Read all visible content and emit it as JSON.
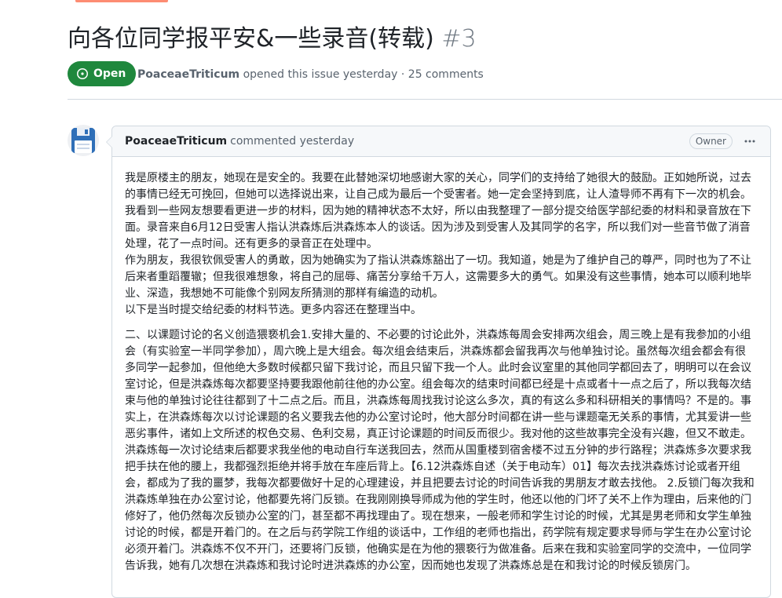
{
  "issue": {
    "title": "向各位同学报平安&一些录音(转载)",
    "number": "#3",
    "state": "Open",
    "author": "PoaceaeTriticum",
    "opened_text": "opened this issue yesterday · 25 comments"
  },
  "comment": {
    "author": "PoaceaeTriticum",
    "time_text": "commented yesterday",
    "badge": "Owner",
    "paragraphs": [
      [
        "我是原楼主的朋友，她现在是安全的。我要在此替她深切地感谢大家的关心，同学们的支持给了她很大的鼓励。正如她所说，过去",
        "的事情已经无可挽回，但她可以选择说出来，让自己成为最后一个受害者。她一定会坚持到底，让人渣导师不再有下一次的机会。",
        "我看到一些网友想要看更进一步的材料，因为她的精神状态不太好，所以由我整理了一部分提交给医学部纪委的材料和录音放在下",
        "面。录音来自6月12日受害人指认洪森炼后洪森炼本人的谈话。因为涉及到受害人及其同学的名字，所以我们对一些音节做了消音",
        "处理，花了一点时间。还有更多的录音正在处理中。",
        "作为朋友，我很钦佩受害人的勇敢，因为她确实为了指认洪森炼豁出了一切。我知道，她是为了维护自己的尊严，同时也为了不让",
        "后来者重蹈覆辙；但我很难想象，将自己的屈辱、痛苦分享给千万人，这需要多大的勇气。如果没有这些事情，她本可以顺利地毕",
        "业、深造，我想她不可能像个别网友所猜测的那样有编造的动机。",
        "以下是当时提交给纪委的材料节选。更多内容还在整理当中。"
      ],
      [
        "二、以课题讨论的名义创造猥亵机会1.安排大量的、不必要的讨论此外，洪森炼每周会安排两次组会，周三晚上是有我参加的小组",
        "会（有实验室一半同学参加），周六晚上是大组会。每次组会结束后，洪森炼都会留我再次与他单独讨论。虽然每次组会都会有很",
        "多同学一起参加，但他绝大多数时候都只留下我讨论，而且只留下我一个人。此时会议室里的其他同学都回去了，明明可以在会议",
        "室讨论，但是洪森炼每次都要坚持要我跟他前往他的办公室。组会每次的结束时间都已经是十点或者十一点之后了，所以我每次结",
        "束与他的单独讨论往往都到了十二点之后。而且，洪森炼每周找我讨论这么多次，真的有这么多和科研相关的事情吗？不是的。事",
        "实上，在洪森炼每次以讨论课题的名义要我去他的办公室讨论时，他大部分时间都在讲一些与课题毫无关系的事情，尤其爱讲一些",
        "恶劣事件，诸如上文所述的权色交易、色利交易，真正讨论课题的时间反而很少。我对他的这些故事完全没有兴趣，但又不敢走。",
        "洪森炼每一次讨论结束后都要求我坐他的电动自行车送我回去，然而从国重楼到宿舍楼不过五分钟的步行路程；洪森炼多次要求我",
        "把手扶在他的腰上，我都强烈拒绝并将手放在车座后背上。【6.12洪森炼自述（关于电动车）01】每次去找洪森炼讨论或者开组",
        "会，都成为了我的噩梦，我每次都要做好十足的心理建设，并且把要去讨论的时间告诉我的男朋友才敢去找他。 2.反锁门每次我和",
        "洪森炼单独在办公室讨论，他都要先将门反锁。在我刚刚换导师成为他的学生时，他还以他的门坏了关不上作为理由，后来他的门",
        "修好了，他仍然每次反锁办公室的门，甚至都不再找理由了。现在想来，一般老师和学生讨论的时候，尤其是男老师和女学生单独",
        "讨论的时候，都是开着门的。在之后与药学院工作组的谈话中，工作组的老师也指出，药学院有规定要求导师与学生在办公室讨论",
        "必须开着门。洪森炼不仅不开门，还要将门反锁，他确实是在为他的猥亵行为做准备。后来在我和实验室同学的交流中，一位同学",
        "告诉我，她有几次想在洪森炼和我讨论时进洪森炼的办公室，因而她也发现了洪森炼总是在和我讨论的时候反锁房门。"
      ]
    ]
  }
}
